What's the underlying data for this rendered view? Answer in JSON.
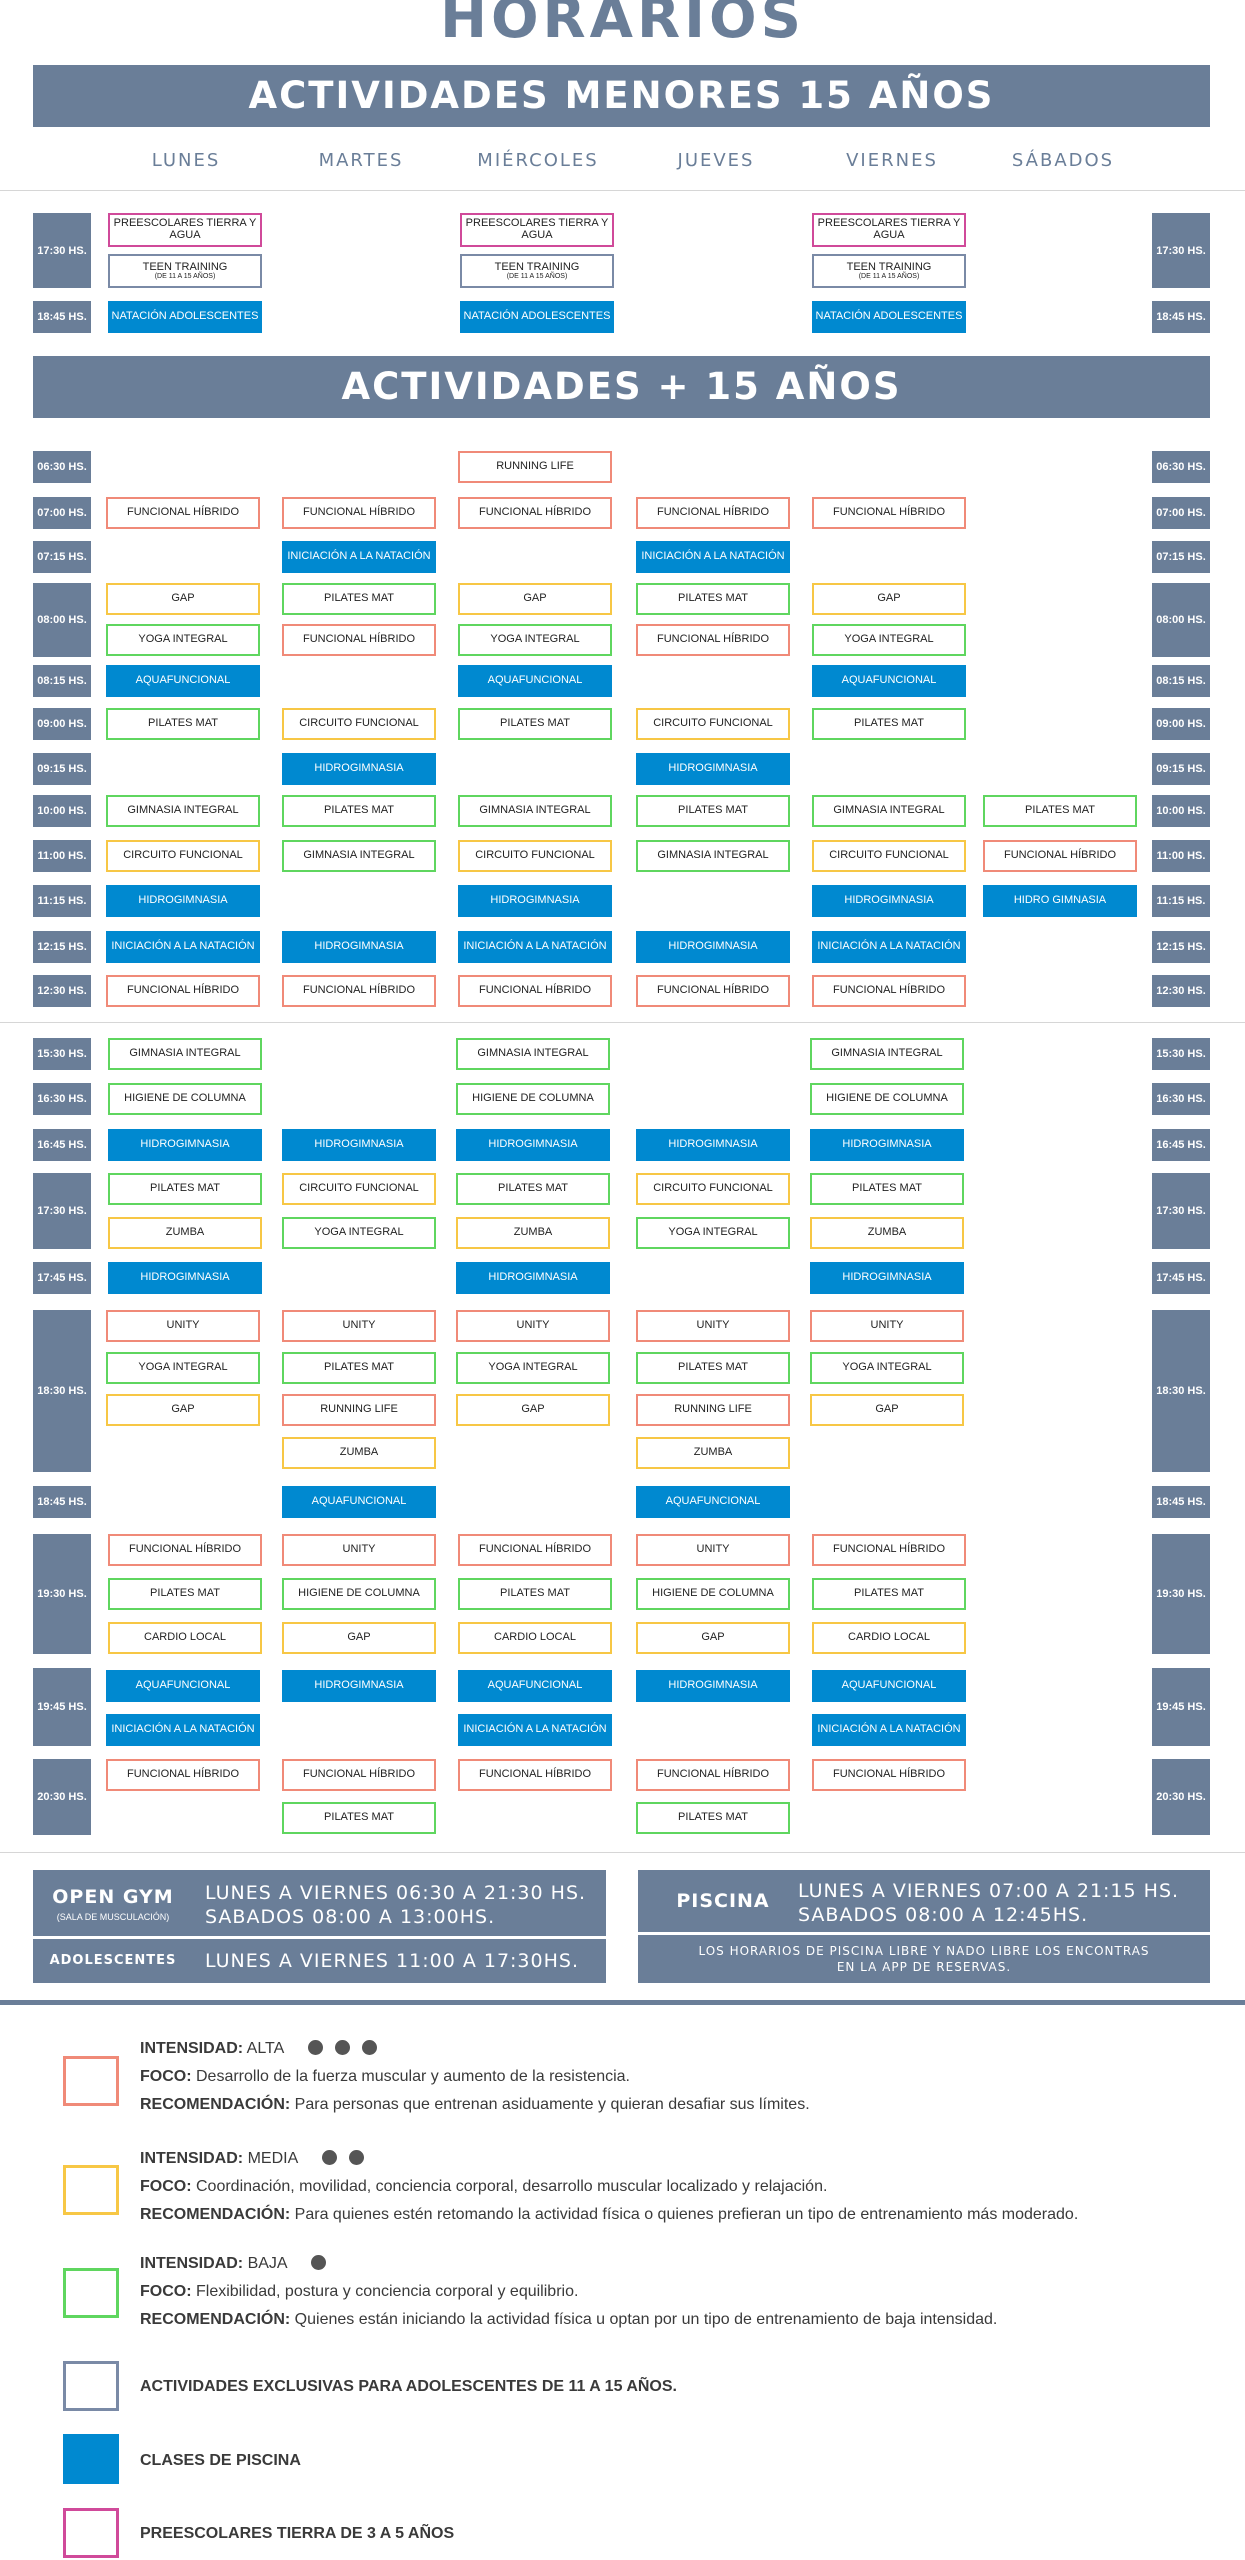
{
  "title": "HORARIOS",
  "banner_kids": "ACTIVIDADES MENORES 15 AÑOS",
  "banner_adults": "ACTIVIDADES + 15 AÑOS",
  "days": [
    "LUNES",
    "MARTES",
    "MIÉRCOLES",
    "JUEVES",
    "VIERNES",
    "SÁBADOS"
  ],
  "colors": {
    "alta": "#f08a78",
    "media": "#f7c745",
    "baja": "#5fd65f",
    "piscina": "#0089d0",
    "adolescentes": "#7a8aa6",
    "preescolares": "#d04a9a",
    "slate": "#6a7e98"
  },
  "kids": {
    "times": [
      "17:30 HS.",
      "18:45 HS."
    ],
    "preescolares": "PREESCOLARES TIERRA Y AGUA",
    "teen": "TEEN TRAINING",
    "teen_sub": "(DE 11 A 15 AÑOS)",
    "natacion": "NATACIÓN ADOLESCENTES"
  },
  "adults_am": {
    "times": [
      "06:30 HS.",
      "07:00 HS.",
      "07:15 HS.",
      "08:00 HS.",
      "08:15 HS.",
      "09:00 HS.",
      "09:15 HS.",
      "10:00 HS.",
      "11:00 HS.",
      "11:15 HS.",
      "12:15 HS.",
      "12:30 HS."
    ]
  },
  "adults_pm": {
    "times": [
      "15:30 HS.",
      "16:30 HS.",
      "16:45 HS.",
      "17:30 HS.",
      "17:45 HS.",
      "18:30 HS.",
      "18:45 HS.",
      "19:30 HS.",
      "19:45 HS.",
      "20:30 HS."
    ]
  },
  "activities": {
    "running_life": "RUNNING LIFE",
    "funcional_hibrido": "FUNCIONAL HÍBRIDO",
    "iniciacion_natacion": "INICIACIÓN A LA NATACIÓN",
    "gap": "GAP",
    "pilates_mat": "PILATES MAT",
    "yoga_integral": "YOGA INTEGRAL",
    "aquafuncional": "AQUAFUNCIONAL",
    "circuito_funcional": "CIRCUITO FUNCIONAL",
    "hidrogimnasia": "HIDROGIMNASIA",
    "hidro_gimnasia": "HIDRO GIMNASIA",
    "gimnasia_integral": "GIMNASIA INTEGRAL",
    "higiene_columna": "HIGIENE DE COLUMNA",
    "zumba": "ZUMBA",
    "unity": "UNITY",
    "cardio_local": "CARDIO LOCAL"
  },
  "info": {
    "open_gym": "OPEN GYM",
    "open_gym_sub": "(SALA DE MUSCULACIÓN)",
    "open_gym_line1": "LUNES A VIERNES 06:30 A 21:30 HS.",
    "open_gym_line2": "SABADOS 08:00 A 13:00HS.",
    "adolescentes": "ADOLESCENTES",
    "adolescentes_line": "LUNES A VIERNES 11:00 A 17:30HS.",
    "piscina": "PISCINA",
    "piscina_line1": "LUNES A VIERNES 07:00 A 21:15 HS.",
    "piscina_line2": "SABADOS 08:00 A 12:45HS.",
    "piscina_note1": "LOS HORARIOS DE PISCINA LIBRE Y NADO LIBRE LOS ENCONTRAS",
    "piscina_note2": "EN LA APP DE RESERVAS."
  },
  "legend": {
    "intensidad_label": "INTENSIDAD:",
    "foco_label": "FOCO:",
    "recomendacion_label": "RECOMENDACIÓN:",
    "alta": {
      "level": "ALTA",
      "dots": 3,
      "foco": "Desarrollo de la fuerza muscular y aumento de la resistencia.",
      "recomendacion": "Para personas que entrenan asiduamente y quieran desafiar sus límites."
    },
    "media": {
      "level": "MEDIA",
      "dots": 2,
      "foco": "Coordinación, movilidad, conciencia corporal, desarrollo muscular localizado y relajación.",
      "recomendacion": "Para quienes estén retomando la actividad física o quienes prefieran un tipo de entrenamiento más moderado."
    },
    "baja": {
      "level": "BAJA",
      "dots": 1,
      "foco": "Flexibilidad, postura y conciencia corporal y equilibrio.",
      "recomendacion": "Quienes están iniciando la actividad física u optan por un tipo de entrenamiento de baja intensidad."
    },
    "adolescentes": "ACTIVIDADES EXCLUSIVAS PARA ADOLESCENTES DE 11 A 15 AÑOS.",
    "piscina": "CLASES DE PISCINA",
    "preescolares": "PREESCOLARES TIERRA DE 3 A 5 AÑOS"
  }
}
